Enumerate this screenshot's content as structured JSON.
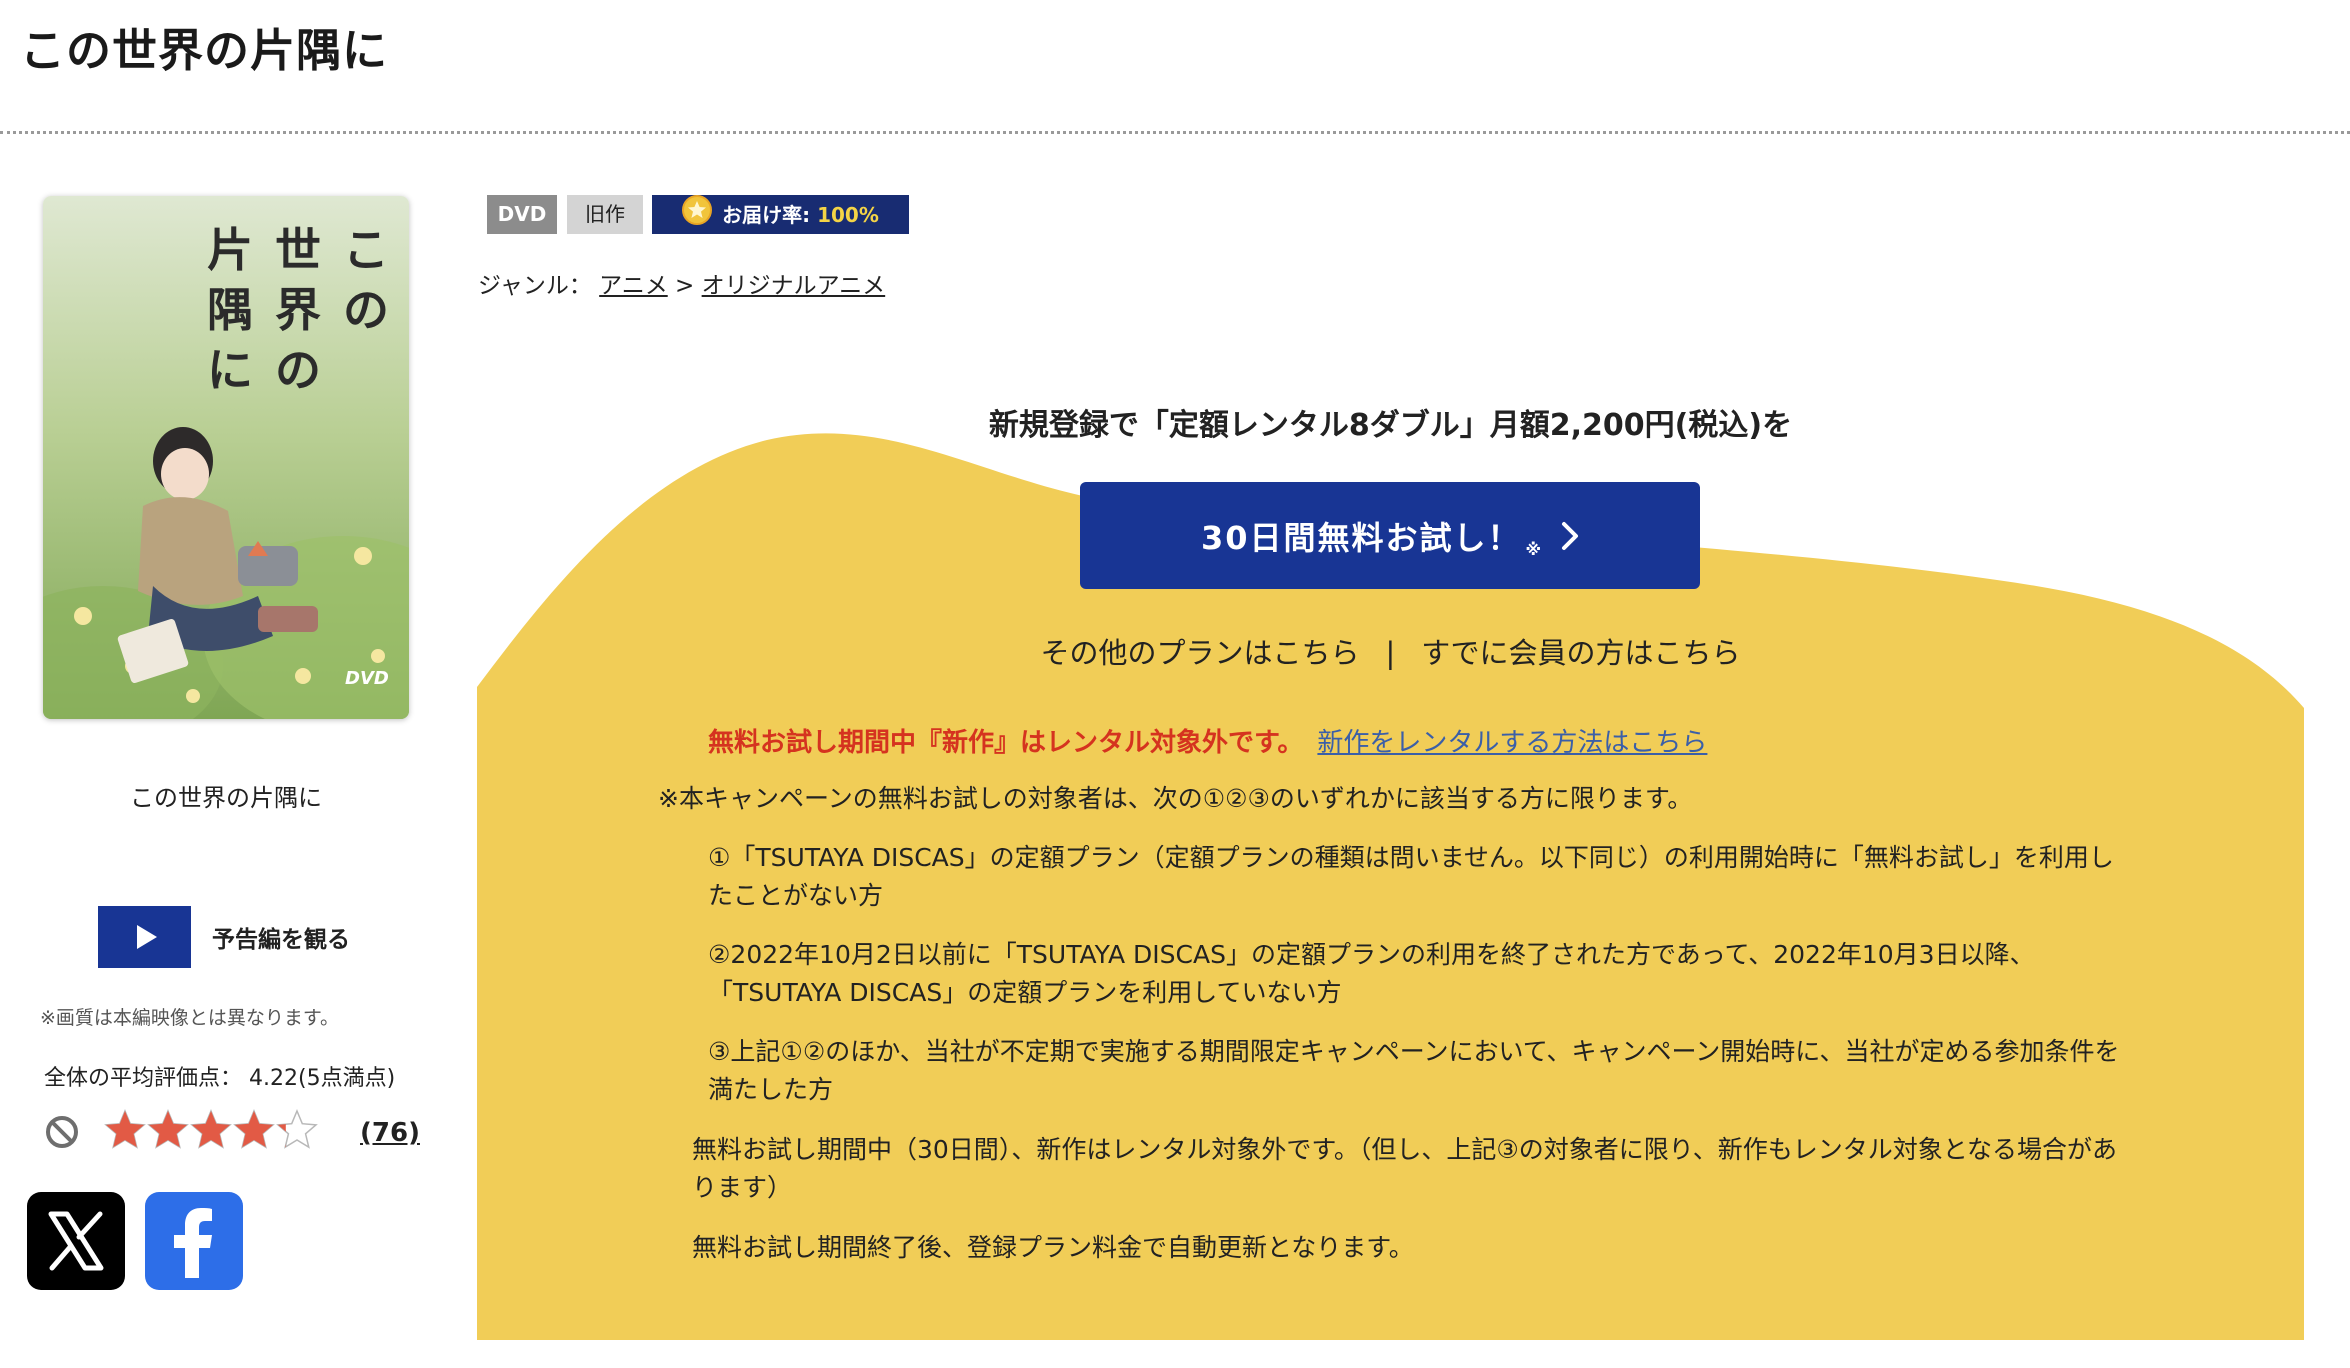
{
  "page": {
    "title": "この世界の片隅に"
  },
  "cover": {
    "title_chars": [
      "こ",
      "の",
      "世",
      "界",
      "の",
      "片",
      "隅",
      "に"
    ],
    "dvd_mark": "DVD",
    "caption": "この世界の片隅に"
  },
  "trailer": {
    "label": "予告編を観る"
  },
  "notes": {
    "image_note": "※画質は本編映像とは異なります。"
  },
  "rating": {
    "label": "全体の平均評価点：",
    "score": "4.22",
    "scale": "(5点満点)",
    "stars_value": 4.22,
    "stars_max": 5,
    "review_count": "(76)",
    "star_color": "#e25a45"
  },
  "share": {
    "x_icon": "x-logo-icon",
    "facebook_icon": "facebook-f-icon",
    "x_color": "#000000",
    "facebook_color": "#2d6ee8"
  },
  "tags": {
    "format": "DVD",
    "release_type": "旧作",
    "delivery_label": "お届け率:",
    "delivery_rate": "100%"
  },
  "genre": {
    "label": "ジャンル：",
    "primary": "アニメ",
    "separator": ">",
    "secondary": "オリジナルアニメ"
  },
  "campaign": {
    "headline": "新規登録で「定額レンタル8ダブル」月額2,200円(税込)を",
    "trial_button": "30日間無料お試し！",
    "trial_mark": "※",
    "other_plans": "その他のプランはこちら",
    "divider": "|",
    "member_login": "すでに会員の方はこちら",
    "notice_red": "無料お試し期間中『新作』はレンタル対象外です。",
    "notice_link": "新作をレンタルする方法はこちら",
    "terms_intro": "※本キャンペーンの無料お試しの対象者は、次の①②③のいずれかに該当する方に限ります。",
    "term_1": "①「TSUTAYA DISCAS」の定額プラン（定額プランの種類は問いません。以下同じ）の利用開始時に「無料お試し」を利用したことがない方",
    "term_2": "②2022年10月2日以前に「TSUTAYA DISCAS」の定額プランの利用を終了された方であって、2022年10月3日以降、「TSUTAYA DISCAS」の定額プランを利用していない方",
    "term_3": "③上記①②のほか、当社が不定期で実施する期間限定キャンペーンにおいて、キャンペーン開始時に、当社が定める参加条件を満たした方",
    "term_4": "無料お試し期間中（30日間）、新作はレンタル対象外です。（但し、上記③の対象者に限り、新作もレンタル対象となる場合があります）",
    "term_5": "無料お試し期間終了後、登録プラン料金で自動更新となります。",
    "bg_color": "#f1cd57",
    "button_color": "#183594",
    "notice_color": "#d5331f"
  }
}
